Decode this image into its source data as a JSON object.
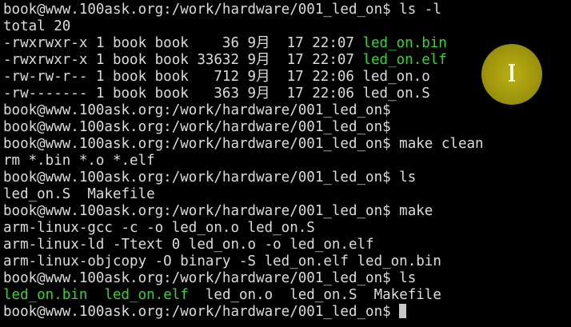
{
  "terminal": {
    "lines": [
      [
        {
          "t": "book@www.100ask.org:/work/hardware/001_led_on$ ls -l",
          "c": "w"
        }
      ],
      [
        {
          "t": "total 20",
          "c": "w"
        }
      ],
      [
        {
          "t": "-rwxrwxr-x 1 book book    36 9月  17 22:07 ",
          "c": "w"
        },
        {
          "t": "led_on.bin",
          "c": "g"
        }
      ],
      [
        {
          "t": "-rwxrwxr-x 1 book book 33632 9月  17 22:07 ",
          "c": "w"
        },
        {
          "t": "led_on.elf",
          "c": "g"
        }
      ],
      [
        {
          "t": "-rw-rw-r-- 1 book book   712 9月  17 22:06 led_on.o",
          "c": "w"
        }
      ],
      [
        {
          "t": "-rw------- 1 book book   363 9月  17 22:06 led_on.S",
          "c": "w"
        }
      ],
      [
        {
          "t": "book@www.100ask.org:/work/hardware/001_led_on$",
          "c": "w"
        }
      ],
      [
        {
          "t": "book@www.100ask.org:/work/hardware/001_led_on$",
          "c": "w"
        }
      ],
      [
        {
          "t": "book@www.100ask.org:/work/hardware/001_led_on$ make clean",
          "c": "w"
        }
      ],
      [
        {
          "t": "rm *.bin *.o *.elf",
          "c": "w"
        }
      ],
      [
        {
          "t": "book@www.100ask.org:/work/hardware/001_led_on$ ls",
          "c": "w"
        }
      ],
      [
        {
          "t": "led_on.S  Makefile",
          "c": "w"
        }
      ],
      [
        {
          "t": "book@www.100ask.org:/work/hardware/001_led_on$ make",
          "c": "w"
        }
      ],
      [
        {
          "t": "arm-linux-gcc -c -o led_on.o led_on.S",
          "c": "w"
        }
      ],
      [
        {
          "t": "arm-linux-ld -Ttext 0 led_on.o -o led_on.elf",
          "c": "w"
        }
      ],
      [
        {
          "t": "arm-linux-objcopy -O binary -S led_on.elf led_on.bin",
          "c": "w"
        }
      ],
      [
        {
          "t": "book@www.100ask.org:/work/hardware/001_led_on$ ls",
          "c": "w"
        }
      ],
      [
        {
          "t": "led_on.bin",
          "c": "g"
        },
        {
          "t": "  ",
          "c": "w"
        },
        {
          "t": "led_on.elf",
          "c": "g"
        },
        {
          "t": "  led_on.o  led_on.S  Makefile",
          "c": "w"
        }
      ],
      [
        {
          "t": "book@www.100ask.org:/work/hardware/001_led_on$ ",
          "c": "w"
        }
      ]
    ],
    "cursor_line": 18
  },
  "overlay": {
    "highlight_color": "#b4aa14",
    "pointer_icon": "ibeam-cursor-icon"
  },
  "colors": {
    "background": "#000000",
    "text": "#dcdcdc",
    "executable": "#33d633"
  }
}
